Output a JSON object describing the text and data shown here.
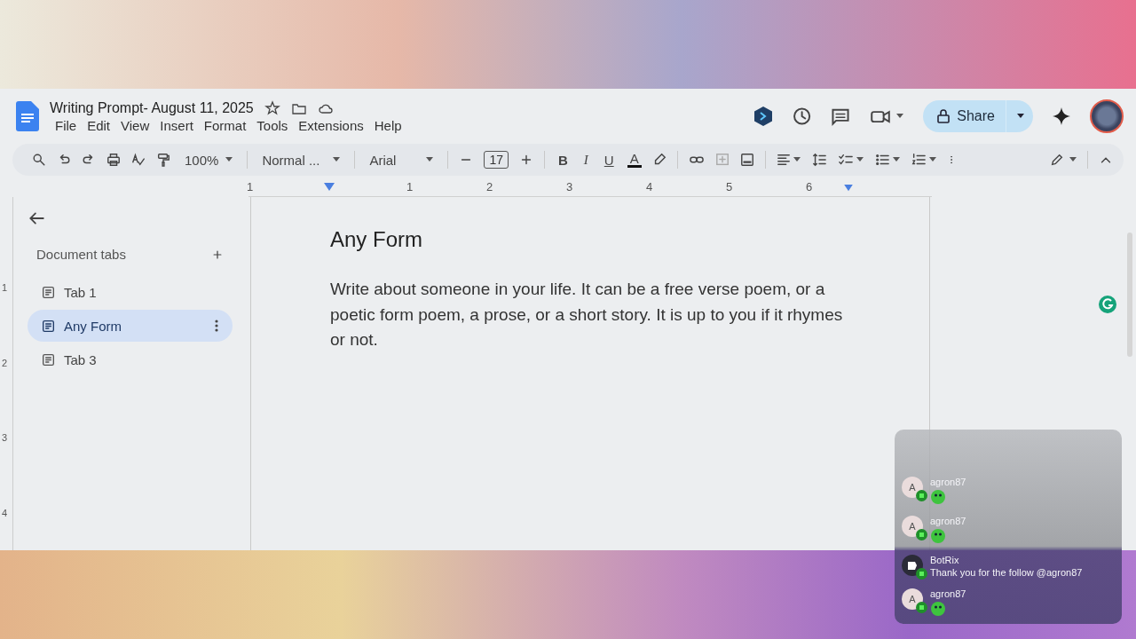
{
  "document": {
    "title": "Writing Prompt- August 11, 2025"
  },
  "menu": [
    "File",
    "Edit",
    "View",
    "Insert",
    "Format",
    "Tools",
    "Extensions",
    "Help"
  ],
  "share_button": {
    "label": "Share"
  },
  "toolbar": {
    "zoom": "100%",
    "style": "Normal ...",
    "font": "Arial",
    "font_size": "17",
    "format_buttons": [
      "B",
      "I",
      "U",
      "A"
    ]
  },
  "ruler": {
    "numbers": [
      "1",
      "1",
      "2",
      "3",
      "4",
      "5",
      "6"
    ]
  },
  "vertical_ruler": {
    "numbers": [
      "1",
      "2",
      "3",
      "4"
    ]
  },
  "sidebar": {
    "heading": "Document tabs",
    "items": [
      {
        "label": "Tab 1",
        "selected": false
      },
      {
        "label": "Any Form",
        "selected": true
      },
      {
        "label": "Tab 3",
        "selected": false
      }
    ]
  },
  "page": {
    "heading": "Any Form",
    "body": "Write about someone in your life. It can be a free verse poem, or a poetic form poem, a prose, or a short story. It is up to you if it rhymes or not."
  },
  "chat": {
    "messages": [
      {
        "user": "agron87",
        "avatar": "A",
        "kind": "emote"
      },
      {
        "user": "agron87",
        "avatar": "A",
        "kind": "emote"
      },
      {
        "user": "BotRix",
        "kind": "text",
        "text": "Thank you for the follow @agron87"
      },
      {
        "user": "agron87",
        "avatar": "A",
        "kind": "emote"
      }
    ]
  }
}
